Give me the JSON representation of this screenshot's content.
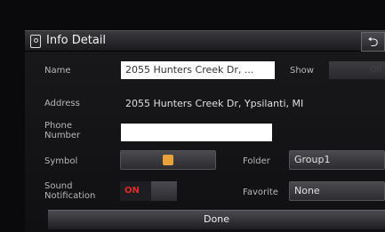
{
  "header": {
    "title": "Info Detail",
    "back_icon": "⮌"
  },
  "form": {
    "name_label": "Name",
    "name_value": "2055 Hunters Creek Dr, ...",
    "show_label": "Show",
    "show_toggle_value": "Off",
    "address_label": "Address",
    "address_value": "2055 Hunters Creek Dr, Ypsilanti, MI",
    "phone_label": "Phone Number",
    "phone_value": "",
    "symbol_label": "Symbol",
    "folder_label": "Folder",
    "folder_value": "Group1",
    "sound_label": "Sound Notification",
    "sound_toggle_value": "ON",
    "favorite_label": "Favorite",
    "favorite_value": "None"
  },
  "footer": {
    "done_label": "Done"
  },
  "colors": {
    "accent_red": "#e02a2a",
    "symbol_orange": "#e9a23a"
  }
}
